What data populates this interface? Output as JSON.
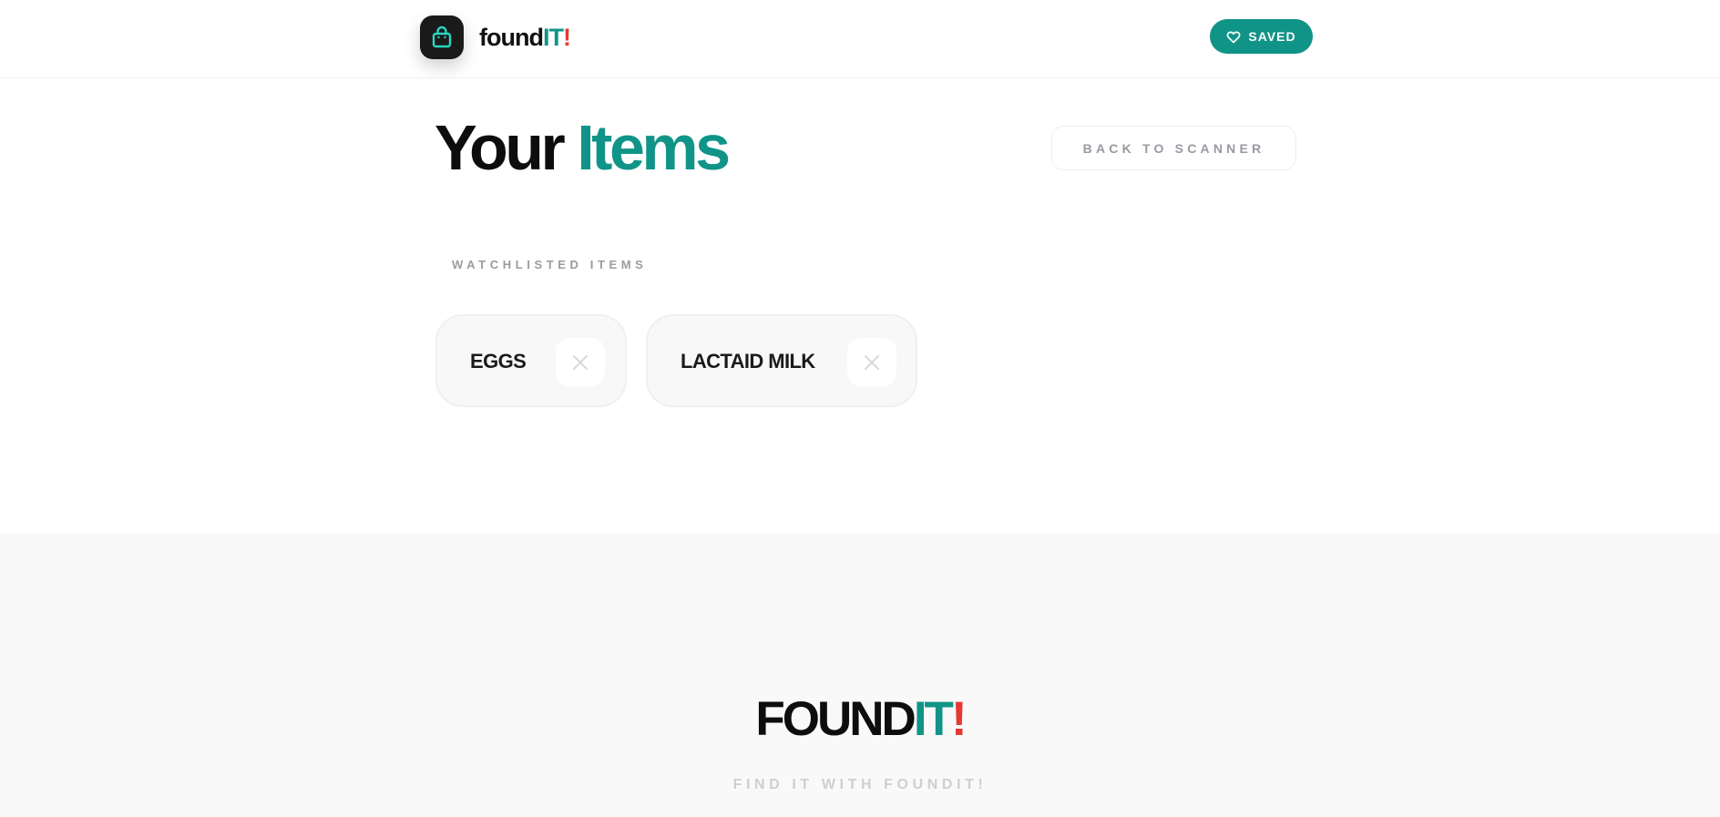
{
  "header": {
    "brand": {
      "part1": "found",
      "part2": "IT",
      "part3": "!"
    },
    "saved_button": {
      "label": "SAVED",
      "icon": "heart-icon"
    },
    "logo_icon": "shopping-bag-icon"
  },
  "main": {
    "title": {
      "part1": "Your ",
      "part2": "Items"
    },
    "back_button": {
      "label": "BACK TO SCANNER"
    },
    "section_label": "WATCHLISTED ITEMS",
    "items": [
      {
        "label": "EGGS",
        "remove_icon": "close-icon"
      },
      {
        "label": "LACTAID MILK",
        "remove_icon": "close-icon"
      }
    ]
  },
  "footer": {
    "brand": {
      "part1": "FOUND",
      "part2": "IT",
      "part3": "!"
    },
    "tagline": "FIND IT WITH FOUNDIT!"
  },
  "colors": {
    "accent": "#119488",
    "exclaim": "#e53935",
    "logo_bg": "#1a1a1a",
    "logo_icon": "#2dd4bf"
  }
}
